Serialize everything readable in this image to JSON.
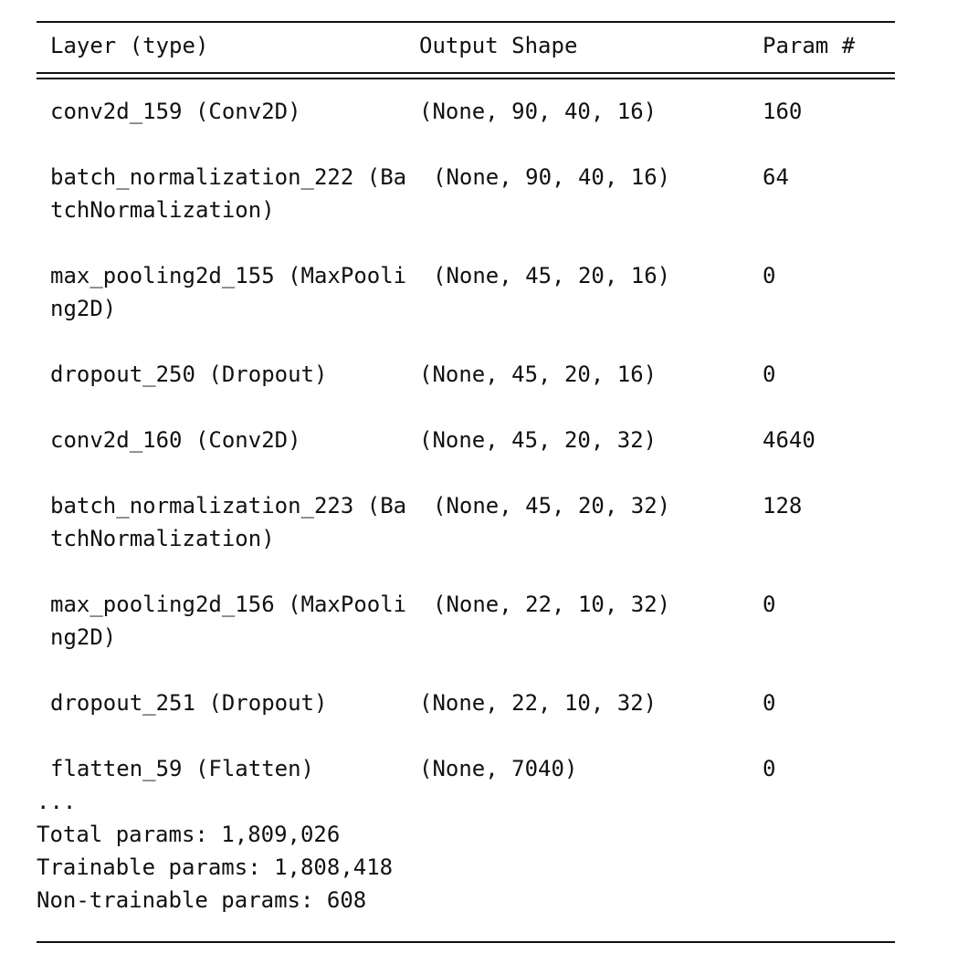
{
  "header": {
    "layer_col": "Layer (type)",
    "shape_col": "Output Shape",
    "param_col": "Param #"
  },
  "rows": [
    {
      "layer": "conv2d_159 (Conv2D)",
      "shape": "(None, 90, 40, 16)",
      "params": "160"
    },
    {
      "layer": "batch_normalization_222 (Ba\ntchNormalization)",
      "shape": "(None, 90, 40, 16)",
      "params": "64"
    },
    {
      "layer": "max_pooling2d_155 (MaxPooli\nng2D)",
      "shape": "(None, 45, 20, 16)",
      "params": "0"
    },
    {
      "layer": "dropout_250 (Dropout)",
      "shape": "(None, 45, 20, 16)",
      "params": "0"
    },
    {
      "layer": "conv2d_160 (Conv2D)",
      "shape": "(None, 45, 20, 32)",
      "params": "4640"
    },
    {
      "layer": "batch_normalization_223 (Ba\ntchNormalization)",
      "shape": "(None, 45, 20, 32)",
      "params": "128"
    },
    {
      "layer": "max_pooling2d_156 (MaxPooli\nng2D)",
      "shape": "(None, 22, 10, 32)",
      "params": "0"
    },
    {
      "layer": "dropout_251 (Dropout)",
      "shape": "(None, 22, 10, 32)",
      "params": "0"
    },
    {
      "layer": "flatten_59 (Flatten)",
      "shape": "(None, 7040)",
      "params": "0"
    }
  ],
  "ellipsis": "...",
  "totals": {
    "total": "Total params: 1,809,026",
    "trainable": "Trainable params: 1,808,418",
    "non_trainable": "Non-trainable params: 608"
  }
}
